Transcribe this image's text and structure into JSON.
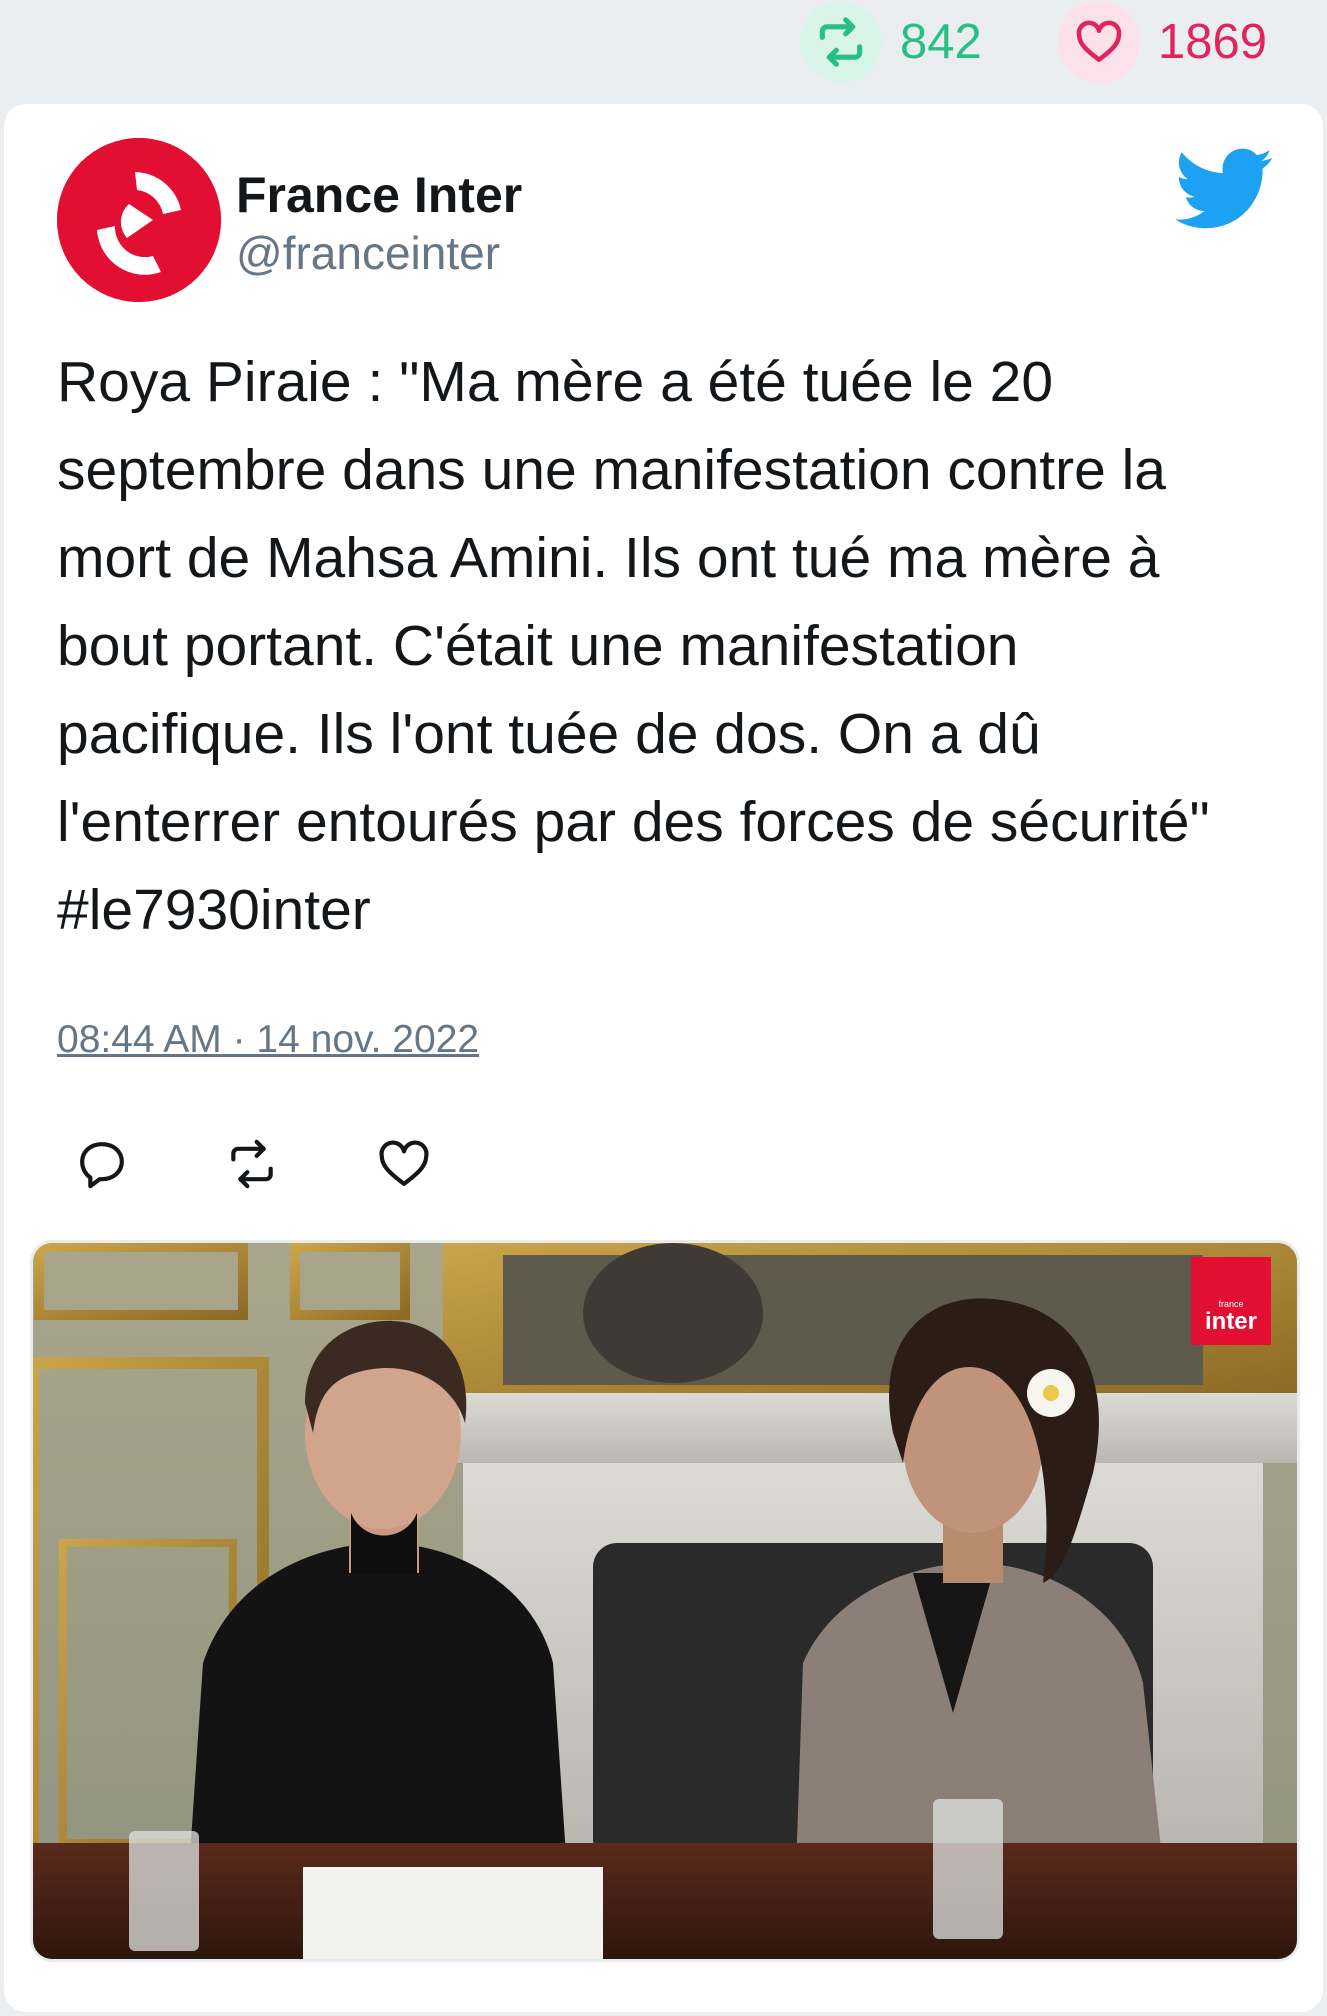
{
  "stats": {
    "retweets": "842",
    "likes": "1869"
  },
  "author": {
    "name": "France Inter",
    "handle": "@franceinter"
  },
  "tweet": {
    "text": "Roya Piraie : \"Ma mère a été tuée le 20 septembre dans une manifestation contre la mort de Mahsa Amini. Ils ont tué ma mère à bout portant. C'était une manifestation pacifique. Ils l'ont tuée de dos. On a dû l'enterrer entourés par des forces de sécurité\" #le7930inter",
    "timestamp": "08:44 AM · 14 nov. 2022"
  },
  "media": {
    "watermark_small": "france",
    "watermark_big": "inter"
  },
  "colors": {
    "retweet_green": "#26c084",
    "like_red": "#e0245e",
    "twitter_blue": "#1da1f2",
    "brand_red": "#e20f33",
    "muted_gray": "#657786"
  }
}
